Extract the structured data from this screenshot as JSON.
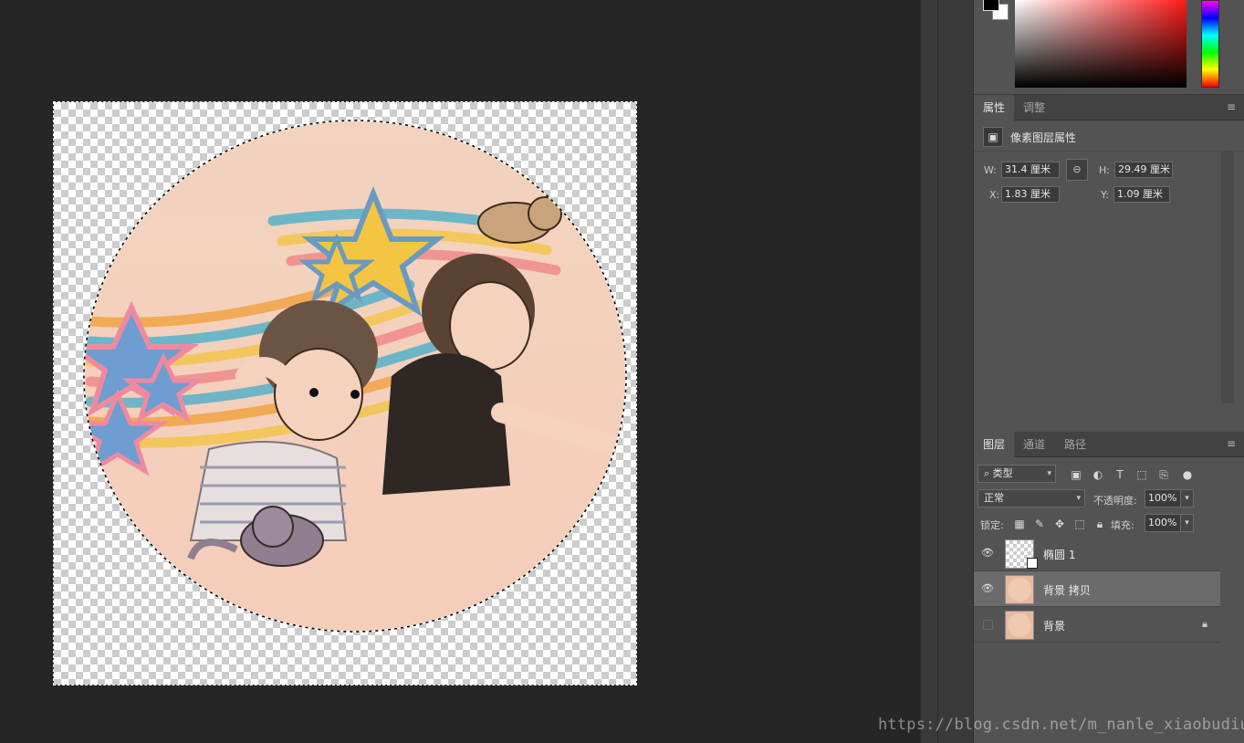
{
  "properties_panel": {
    "tabs": [
      {
        "label": "属性"
      },
      {
        "label": "调整"
      }
    ],
    "title": "像素图层属性",
    "w_label": "W:",
    "w_value": "31.4 厘米",
    "h_label": "H:",
    "h_value": "29.49 厘米",
    "x_label": "X:",
    "x_value": "1.83 厘米",
    "y_label": "Y:",
    "y_value": "1.09 厘米"
  },
  "layers_panel": {
    "tabs": [
      {
        "label": "图层"
      },
      {
        "label": "通道"
      },
      {
        "label": "路径"
      }
    ],
    "filter_kind": "类型",
    "blend_mode": "正常",
    "opacity_label": "不透明度:",
    "opacity_value": "100%",
    "lock_label": "锁定:",
    "fill_label": "填充:",
    "fill_value": "100%",
    "layers": [
      {
        "name": "椭圆 1",
        "visible": true,
        "selected": false,
        "locked": false
      },
      {
        "name": "背景 拷贝",
        "visible": true,
        "selected": true,
        "locked": false
      },
      {
        "name": "背景",
        "visible": false,
        "selected": false,
        "locked": true
      }
    ]
  },
  "colors": {
    "foreground": "#000000",
    "background": "#ffffff"
  },
  "watermark": "https://blog.csdn.net/m_nanle_xiaobudiu",
  "icons": {
    "link": "link-icon",
    "menu": "panel-menu-icon",
    "eye": "eye-icon",
    "lock": "lock-icon"
  }
}
